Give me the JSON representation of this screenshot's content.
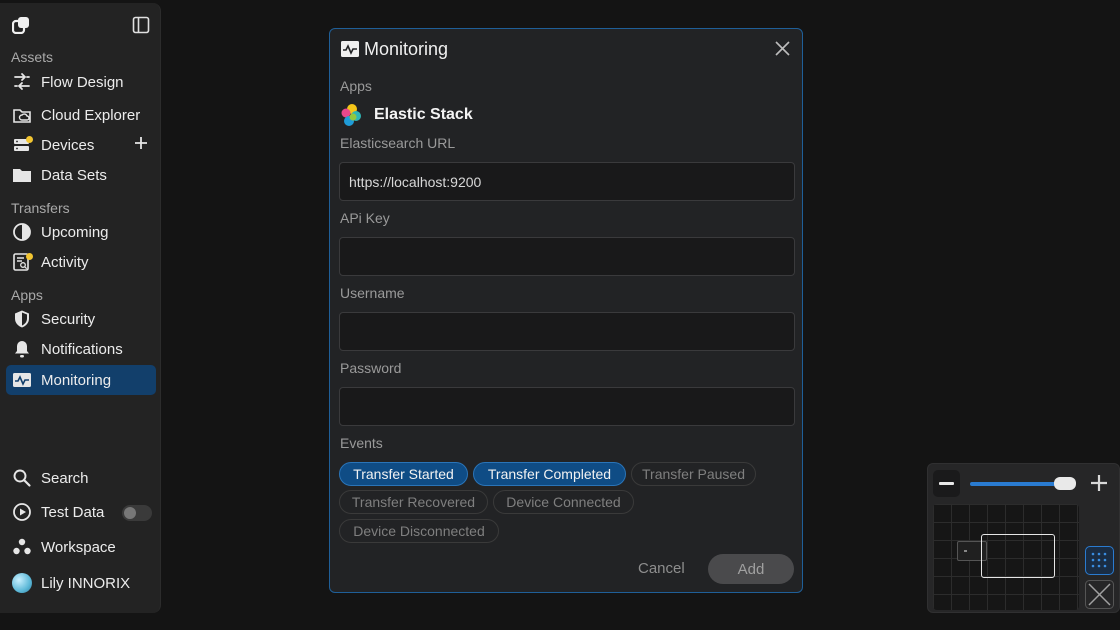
{
  "sidebar": {
    "sections": {
      "assets": "Assets",
      "transfers": "Transfers",
      "apps": "Apps"
    },
    "items": {
      "flow_design": "Flow Design",
      "cloud_explorer": "Cloud Explorer",
      "devices": "Devices",
      "data_sets": "Data Sets",
      "upcoming": "Upcoming",
      "activity": "Activity",
      "security": "Security",
      "notifications": "Notifications",
      "monitoring": "Monitoring",
      "search": "Search",
      "test_data": "Test Data",
      "workspace": "Workspace",
      "user": "Lily INNORIX"
    },
    "test_data_toggle": false,
    "active_item": "Monitoring",
    "badge_color": "#f2c531",
    "active_color": "#123f6b"
  },
  "modal": {
    "title": "Monitoring",
    "apps_label": "Apps",
    "app_name": "Elastic Stack",
    "url_label": "Elasticsearch URL",
    "url_value": "https://localhost:9200",
    "api_key_label": "APi Key",
    "api_key_value": "",
    "username_label": "Username",
    "username_value": "",
    "password_label": "Password",
    "password_value": "",
    "events_label": "Events",
    "events": [
      {
        "label": "Transfer Started",
        "selected": true
      },
      {
        "label": "Transfer Completed",
        "selected": true
      },
      {
        "label": "Transfer Paused",
        "selected": false
      },
      {
        "label": "Transfer Recovered",
        "selected": false
      },
      {
        "label": "Device Connected",
        "selected": false
      },
      {
        "label": "Device Disconnected",
        "selected": false
      }
    ],
    "cancel_label": "Cancel",
    "add_label": "Add",
    "accent_color": "#1f5f98"
  },
  "minimap": {
    "zoom_level": 0.85,
    "icons": [
      "zoom-out-icon",
      "zoom-in-icon",
      "grid-dots-icon",
      "cross-icon"
    ]
  }
}
